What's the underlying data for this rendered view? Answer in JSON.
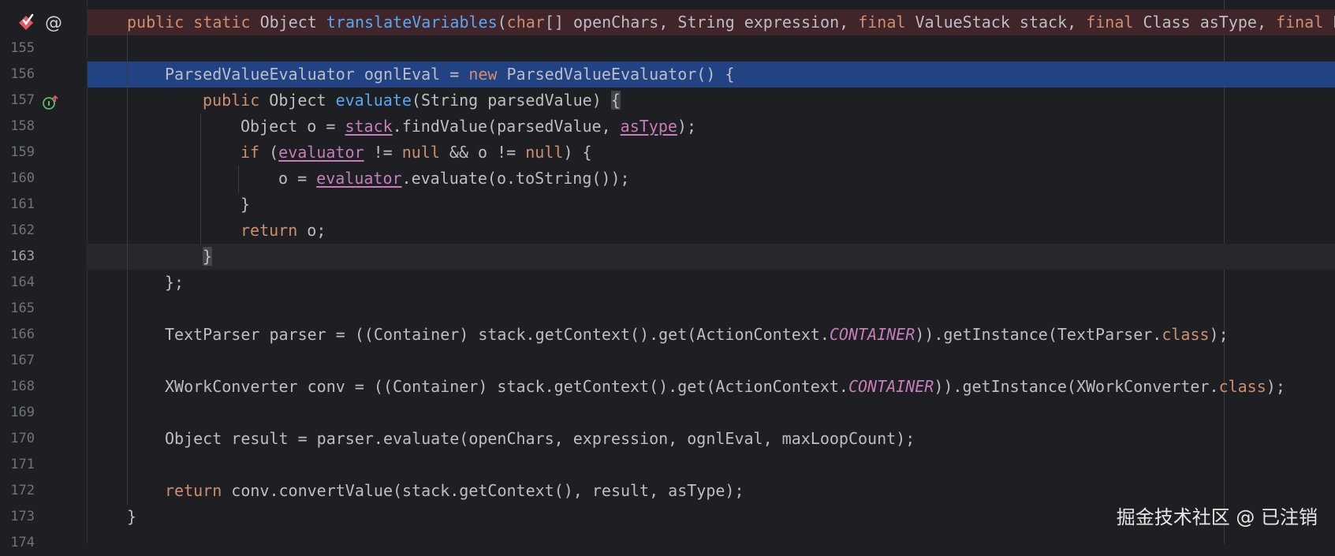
{
  "editor": {
    "lines": [
      {
        "num": "",
        "tokens": [
          {
            "t": "public static ",
            "c": "kw"
          },
          {
            "t": "Object "
          },
          {
            "t": "translateVariables",
            "c": "fn"
          },
          {
            "t": "("
          },
          {
            "t": "char",
            "c": "kw"
          },
          {
            "t": "[] openChars, String expression, "
          },
          {
            "t": "final ",
            "c": "kw"
          },
          {
            "t": "ValueStack stack, "
          },
          {
            "t": "final ",
            "c": "kw"
          },
          {
            "t": "Class asType, "
          },
          {
            "t": "final ",
            "c": "kw"
          },
          {
            "t": "P"
          }
        ],
        "indent": 0,
        "style": "breakpoint"
      },
      {
        "num": "155",
        "tokens": [],
        "indent": 0
      },
      {
        "num": "156",
        "tokens": [
          {
            "t": "ParsedValueEvaluator ognlEval = "
          },
          {
            "t": "new ",
            "c": "kw"
          },
          {
            "t": "ParsedValueEvaluator() {"
          }
        ],
        "indent": 1,
        "style": "selected"
      },
      {
        "num": "157",
        "tokens": [
          {
            "t": "public ",
            "c": "kw"
          },
          {
            "t": "Object "
          },
          {
            "t": "evaluate",
            "c": "fn"
          },
          {
            "t": "(String parsedValue) "
          },
          {
            "t": "{",
            "c": "brace"
          }
        ],
        "indent": 2
      },
      {
        "num": "158",
        "tokens": [
          {
            "t": "Object o = "
          },
          {
            "t": "stack",
            "c": "field"
          },
          {
            "t": ".findValue(parsedValue, "
          },
          {
            "t": "asType",
            "c": "field"
          },
          {
            "t": ");"
          }
        ],
        "indent": 3
      },
      {
        "num": "159",
        "tokens": [
          {
            "t": "if ",
            "c": "kw"
          },
          {
            "t": "("
          },
          {
            "t": "evaluator",
            "c": "field"
          },
          {
            "t": " != "
          },
          {
            "t": "null",
            "c": "kw"
          },
          {
            "t": " && o != "
          },
          {
            "t": "null",
            "c": "kw"
          },
          {
            "t": ") {"
          }
        ],
        "indent": 3
      },
      {
        "num": "160",
        "tokens": [
          {
            "t": "o = "
          },
          {
            "t": "evaluator",
            "c": "field"
          },
          {
            "t": ".evaluate(o.toString());"
          }
        ],
        "indent": 4
      },
      {
        "num": "161",
        "tokens": [
          {
            "t": "}"
          }
        ],
        "indent": 3
      },
      {
        "num": "162",
        "tokens": [
          {
            "t": "return ",
            "c": "kw"
          },
          {
            "t": "o;"
          }
        ],
        "indent": 3
      },
      {
        "num": "163",
        "tokens": [
          {
            "t": "}",
            "c": "brace"
          }
        ],
        "indent": 2,
        "style": "caret"
      },
      {
        "num": "164",
        "tokens": [
          {
            "t": "};"
          }
        ],
        "indent": 1
      },
      {
        "num": "165",
        "tokens": [],
        "indent": 0
      },
      {
        "num": "166",
        "tokens": [
          {
            "t": "TextParser parser = ((Container) stack.getContext().get(ActionContext."
          },
          {
            "t": "CONTAINER",
            "c": "const"
          },
          {
            "t": ")).getInstance(TextParser."
          },
          {
            "t": "class",
            "c": "kw"
          },
          {
            "t": ");"
          }
        ],
        "indent": 1
      },
      {
        "num": "167",
        "tokens": [],
        "indent": 0
      },
      {
        "num": "168",
        "tokens": [
          {
            "t": "XWorkConverter conv = ((Container) stack.getContext().get(ActionContext."
          },
          {
            "t": "CONTAINER",
            "c": "const"
          },
          {
            "t": ")).getInstance(XWorkConverter."
          },
          {
            "t": "class",
            "c": "kw"
          },
          {
            "t": ");"
          }
        ],
        "indent": 1
      },
      {
        "num": "169",
        "tokens": [],
        "indent": 0
      },
      {
        "num": "170",
        "tokens": [
          {
            "t": "Object result = parser.evaluate(openChars, expression, ognlEval, maxLoopCount);"
          }
        ],
        "indent": 1
      },
      {
        "num": "171",
        "tokens": [],
        "indent": 0
      },
      {
        "num": "172",
        "tokens": [
          {
            "t": "return ",
            "c": "kw"
          },
          {
            "t": "conv.convertValue(stack.getContext(), result, asType);"
          }
        ],
        "indent": 1
      },
      {
        "num": "173",
        "tokens": [
          {
            "t": "}"
          }
        ],
        "indent": 0
      },
      {
        "num": "174",
        "tokens": [],
        "indent": 0
      }
    ],
    "current_line": "163"
  },
  "gutter_icons": {
    "breakpoint_icon": "breakpoint-check-icon",
    "annotation_icon": "at-sign-icon",
    "implements_icon": "implements-up-arrow-icon",
    "annotation_glyph": "@"
  },
  "watermark": {
    "text": "掘金技术社区 @ 已注销"
  },
  "colors": {
    "background": "#1e1f22",
    "keyword": "#cf8e6d",
    "function": "#56a8f5",
    "field": "#c77dbb",
    "selection": "#214283",
    "breakpoint_line": "#40252b"
  }
}
